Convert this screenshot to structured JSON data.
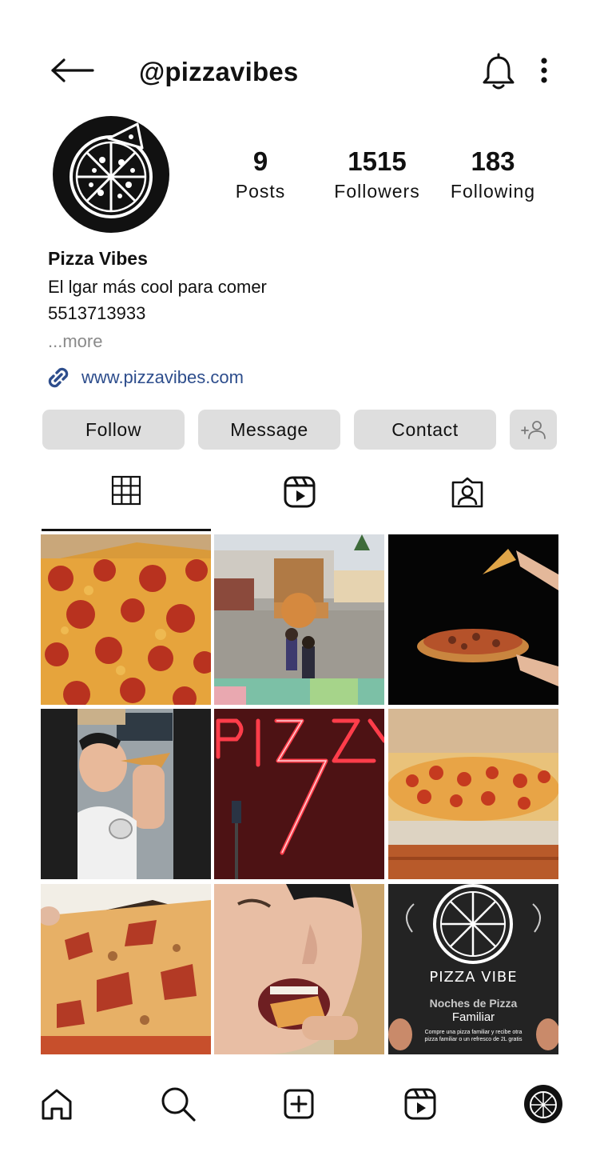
{
  "header": {
    "handle": "@pizzavibes",
    "back_icon": "arrow-left-icon",
    "bell_icon": "bell-icon",
    "more_icon": "more-vertical-icon"
  },
  "profile": {
    "avatar_icon": "pizza-logo-icon",
    "stats": {
      "posts": {
        "value": "9",
        "label": "Posts"
      },
      "followers": {
        "value": "1515",
        "label": "Followers"
      },
      "following": {
        "value": "183",
        "label": "Following"
      }
    },
    "name": "Pizza Vibes",
    "bio_line1": "El lgar más cool para comer",
    "bio_line2": "5513713933",
    "more_label": "...more",
    "link_icon": "link-icon",
    "link": "www.pizzavibes.com"
  },
  "actions": {
    "follow": "Follow",
    "message": "Message",
    "contact": "Contact",
    "add_user_icon": "add-user-icon"
  },
  "tabs": [
    {
      "name": "grid",
      "icon": "grid-icon",
      "active": true
    },
    {
      "name": "reels",
      "icon": "reels-icon",
      "active": false
    },
    {
      "name": "tagged",
      "icon": "tagged-person-icon",
      "active": false
    }
  ],
  "posts": {
    "promo_title": "PIZZA VIBE",
    "promo_subtitle": "Noches de Pizza",
    "promo_subtitle2": "Familiar",
    "promo_body": "Compre una pizza familiar y recibe otra pizza familiar o un refresco de 2L gratis"
  },
  "bottom_nav": [
    "home-icon",
    "search-icon",
    "create-icon",
    "reels-icon",
    "profile-avatar-icon"
  ],
  "colors": {
    "accent_link": "#2d4d8c",
    "button_bg": "#dedede",
    "muted_text": "#8a8a8a"
  }
}
